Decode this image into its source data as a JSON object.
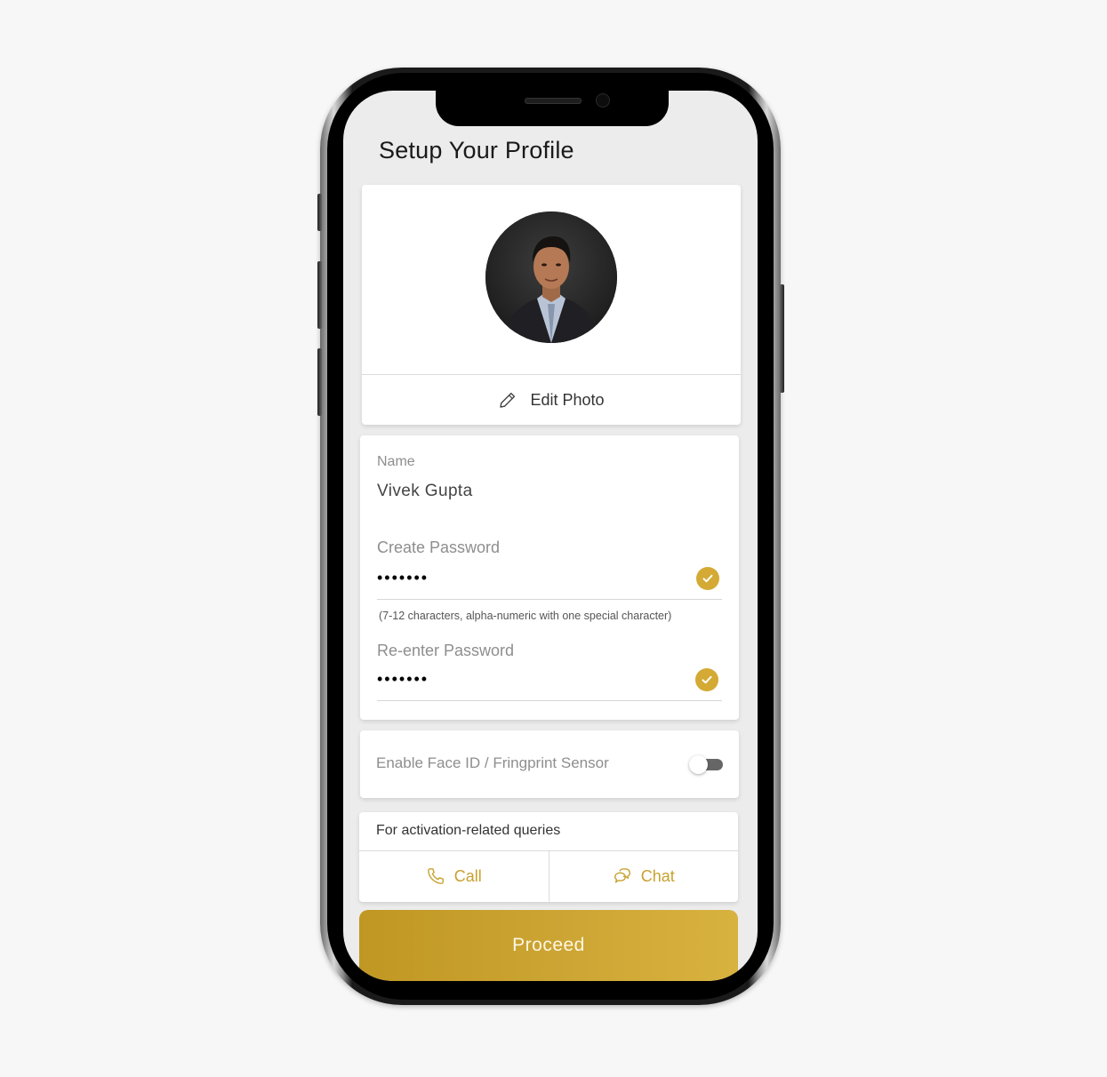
{
  "header": {
    "title": "Setup Your Profile"
  },
  "photo": {
    "avatar_alt": "Profile photo",
    "edit_label": "Edit Photo",
    "edit_icon": "pencil-icon"
  },
  "form": {
    "name": {
      "label": "Name",
      "value": "Vivek Gupta"
    },
    "create_password": {
      "label": "Create Password",
      "value": "•••••••",
      "valid": true,
      "status_icon": "check-circle-icon",
      "hint": "(7-12 characters, alpha-numeric with one special character)"
    },
    "reenter_password": {
      "label": "Re-enter Password",
      "value": "•••••••",
      "valid": true,
      "status_icon": "check-circle-icon"
    }
  },
  "biometric": {
    "label": "Enable Face ID / Fringprint Sensor",
    "enabled": false
  },
  "support": {
    "title": "For activation-related queries",
    "call": {
      "label": "Call",
      "icon": "phone-icon"
    },
    "chat": {
      "label": "Chat",
      "icon": "chat-bubbles-icon"
    }
  },
  "actions": {
    "proceed_label": "Proceed"
  },
  "colors": {
    "accent": "#d4aa35",
    "accent_text": "#c8a12e",
    "button_gradient_start": "#c09722",
    "button_gradient_end": "#d8b23f",
    "toggle_track_off": "#666666"
  }
}
